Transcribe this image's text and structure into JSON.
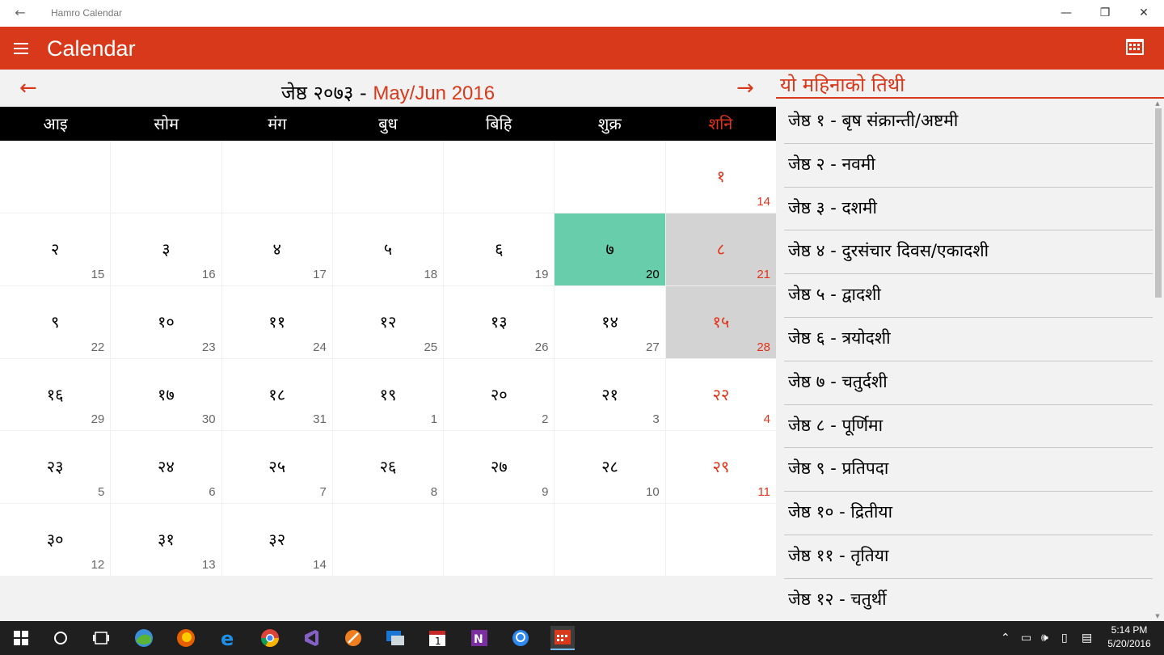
{
  "window": {
    "title": "Hamro Calendar",
    "back_icon": "←",
    "minimize_icon": "—",
    "restore_icon": "❐",
    "close_icon": "✕"
  },
  "appbar": {
    "title": "Calendar"
  },
  "month_nav": {
    "prev_icon": "←",
    "next_icon": "→",
    "nepali_month": "जेष्ठ २०७३",
    "separator": " - ",
    "english_month": "May/Jun  2016"
  },
  "weekdays": [
    "आइ",
    "सोम",
    "मंग",
    "बुध",
    "बिहि",
    "शुक्र",
    "शनि"
  ],
  "calendar": {
    "cells": [
      {
        "np": "",
        "en": ""
      },
      {
        "np": "",
        "en": ""
      },
      {
        "np": "",
        "en": ""
      },
      {
        "np": "",
        "en": ""
      },
      {
        "np": "",
        "en": ""
      },
      {
        "np": "",
        "en": ""
      },
      {
        "np": "१",
        "en": "14"
      },
      {
        "np": "२",
        "en": "15"
      },
      {
        "np": "३",
        "en": "16"
      },
      {
        "np": "४",
        "en": "17"
      },
      {
        "np": "५",
        "en": "18"
      },
      {
        "np": "६",
        "en": "19"
      },
      {
        "np": "७",
        "en": "20",
        "state": "today"
      },
      {
        "np": "८",
        "en": "21",
        "state": "holiday"
      },
      {
        "np": "९",
        "en": "22"
      },
      {
        "np": "१०",
        "en": "23"
      },
      {
        "np": "११",
        "en": "24"
      },
      {
        "np": "१२",
        "en": "25"
      },
      {
        "np": "१३",
        "en": "26"
      },
      {
        "np": "१४",
        "en": "27"
      },
      {
        "np": "१५",
        "en": "28",
        "state": "holiday"
      },
      {
        "np": "१६",
        "en": "29"
      },
      {
        "np": "१७",
        "en": "30"
      },
      {
        "np": "१८",
        "en": "31"
      },
      {
        "np": "१९",
        "en": "1"
      },
      {
        "np": "२०",
        "en": "2"
      },
      {
        "np": "२१",
        "en": "3"
      },
      {
        "np": "२२",
        "en": "4"
      },
      {
        "np": "२३",
        "en": "5"
      },
      {
        "np": "२४",
        "en": "6"
      },
      {
        "np": "२५",
        "en": "7"
      },
      {
        "np": "२६",
        "en": "8"
      },
      {
        "np": "२७",
        "en": "9"
      },
      {
        "np": "२८",
        "en": "10"
      },
      {
        "np": "२९",
        "en": "11"
      },
      {
        "np": "३०",
        "en": "12"
      },
      {
        "np": "३१",
        "en": "13"
      },
      {
        "np": "३२",
        "en": "14"
      },
      {
        "np": "",
        "en": ""
      },
      {
        "np": "",
        "en": ""
      },
      {
        "np": "",
        "en": ""
      },
      {
        "np": "",
        "en": ""
      }
    ]
  },
  "panel": {
    "title": "यो महिनाको तिथी",
    "items": [
      "जेष्ठ १ - बृष संक्रान्ती/अष्टमी",
      "जेष्ठ २ - नवमी",
      "जेष्ठ ३ - दशमी",
      "जेष्ठ ४ - दुरसंचार दिवस/एकादशी",
      "जेष्ठ ५ - द्वादशी",
      "जेष्ठ ६ - त्रयोदशी",
      "जेष्ठ ७ - चतुर्दशी",
      "जेष्ठ ८ - पूर्णिमा",
      "जेष्ठ ९ - प्रतिपदा",
      "जेष्ठ १० - द्रितीया",
      "जेष्ठ ११ - तृतिया",
      "जेष्ठ १२ - चतुर्थी"
    ]
  },
  "taskbar": {
    "time": "5:14 PM",
    "date": "5/20/2016"
  },
  "colors": {
    "accent": "#d9391b",
    "today": "#67cdaa",
    "holiday": "#d3d3d3",
    "saturday": "#e23219"
  }
}
